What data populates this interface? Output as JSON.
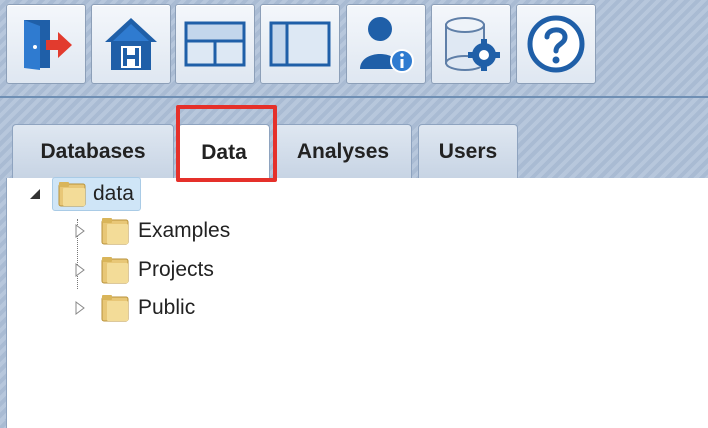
{
  "toolbar": {
    "buttons": [
      {
        "icon": "exit-icon"
      },
      {
        "icon": "home-icon"
      },
      {
        "icon": "horizontal-split-layout-icon"
      },
      {
        "icon": "vertical-split-layout-icon"
      },
      {
        "icon": "user-info-icon"
      },
      {
        "icon": "database-settings-icon"
      },
      {
        "icon": "help-icon"
      }
    ]
  },
  "tabs": [
    {
      "label": "Databases",
      "active": false
    },
    {
      "label": "Data",
      "active": true
    },
    {
      "label": "Analyses",
      "active": false
    },
    {
      "label": "Users",
      "active": false
    }
  ],
  "tree": {
    "root": {
      "label": "data",
      "expanded": true
    },
    "children": [
      {
        "label": "Examples",
        "expanded": false
      },
      {
        "label": "Projects",
        "expanded": false
      },
      {
        "label": "Public",
        "expanded": false
      }
    ]
  },
  "colors": {
    "highlight": "#e5302a",
    "accent_blue": "#1f5fa8",
    "selection": "#cfe5f7"
  }
}
